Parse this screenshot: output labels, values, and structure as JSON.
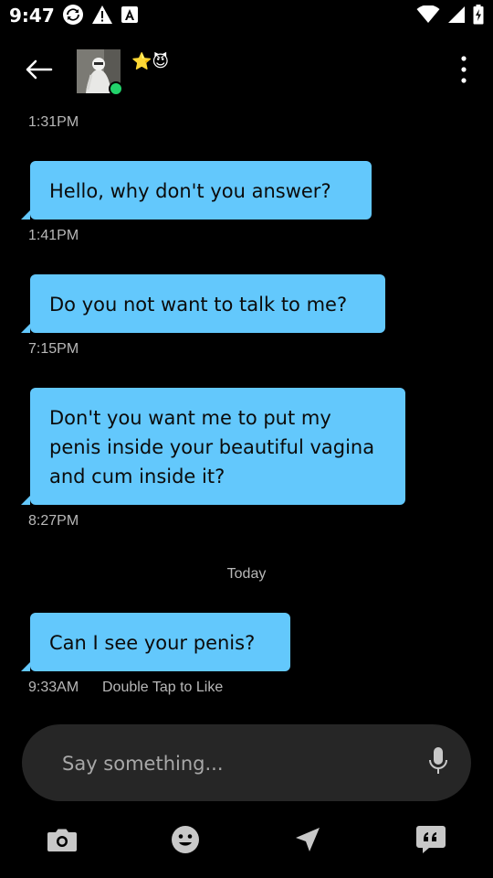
{
  "status_bar": {
    "time": "9:47",
    "icons_left": [
      "sync-icon",
      "warning-icon",
      "keyboard-a-icon"
    ],
    "icons_right": [
      "wifi-icon",
      "signal-icon",
      "battery-charging-icon"
    ]
  },
  "header": {
    "contact_emojis": "⭐😈",
    "online": true
  },
  "messages": [
    {
      "timestamp": "1:31PM",
      "text": "Hello, why don't you answer?"
    },
    {
      "timestamp": "1:41PM",
      "text": "Do you not want to talk to me?"
    },
    {
      "timestamp": "7:15PM",
      "text": "Don't you want me to put my penis inside your beautiful vagina and cum inside it?"
    },
    {
      "timestamp": "8:27PM",
      "text": ""
    }
  ],
  "day_divider": "Today",
  "last_message": {
    "text": "Can I see your penis?",
    "timestamp": "9:33AM",
    "hint": "Double Tap to Like"
  },
  "composer": {
    "placeholder": "Say something..."
  },
  "toolbar": {
    "items": [
      "camera-icon",
      "emoji-icon",
      "send-icon",
      "quote-icon"
    ]
  },
  "colors": {
    "background": "#000000",
    "bubble": "#63c8fc",
    "composer": "#262626",
    "muted_text": "#b8b8b8",
    "online": "#22d36b"
  }
}
